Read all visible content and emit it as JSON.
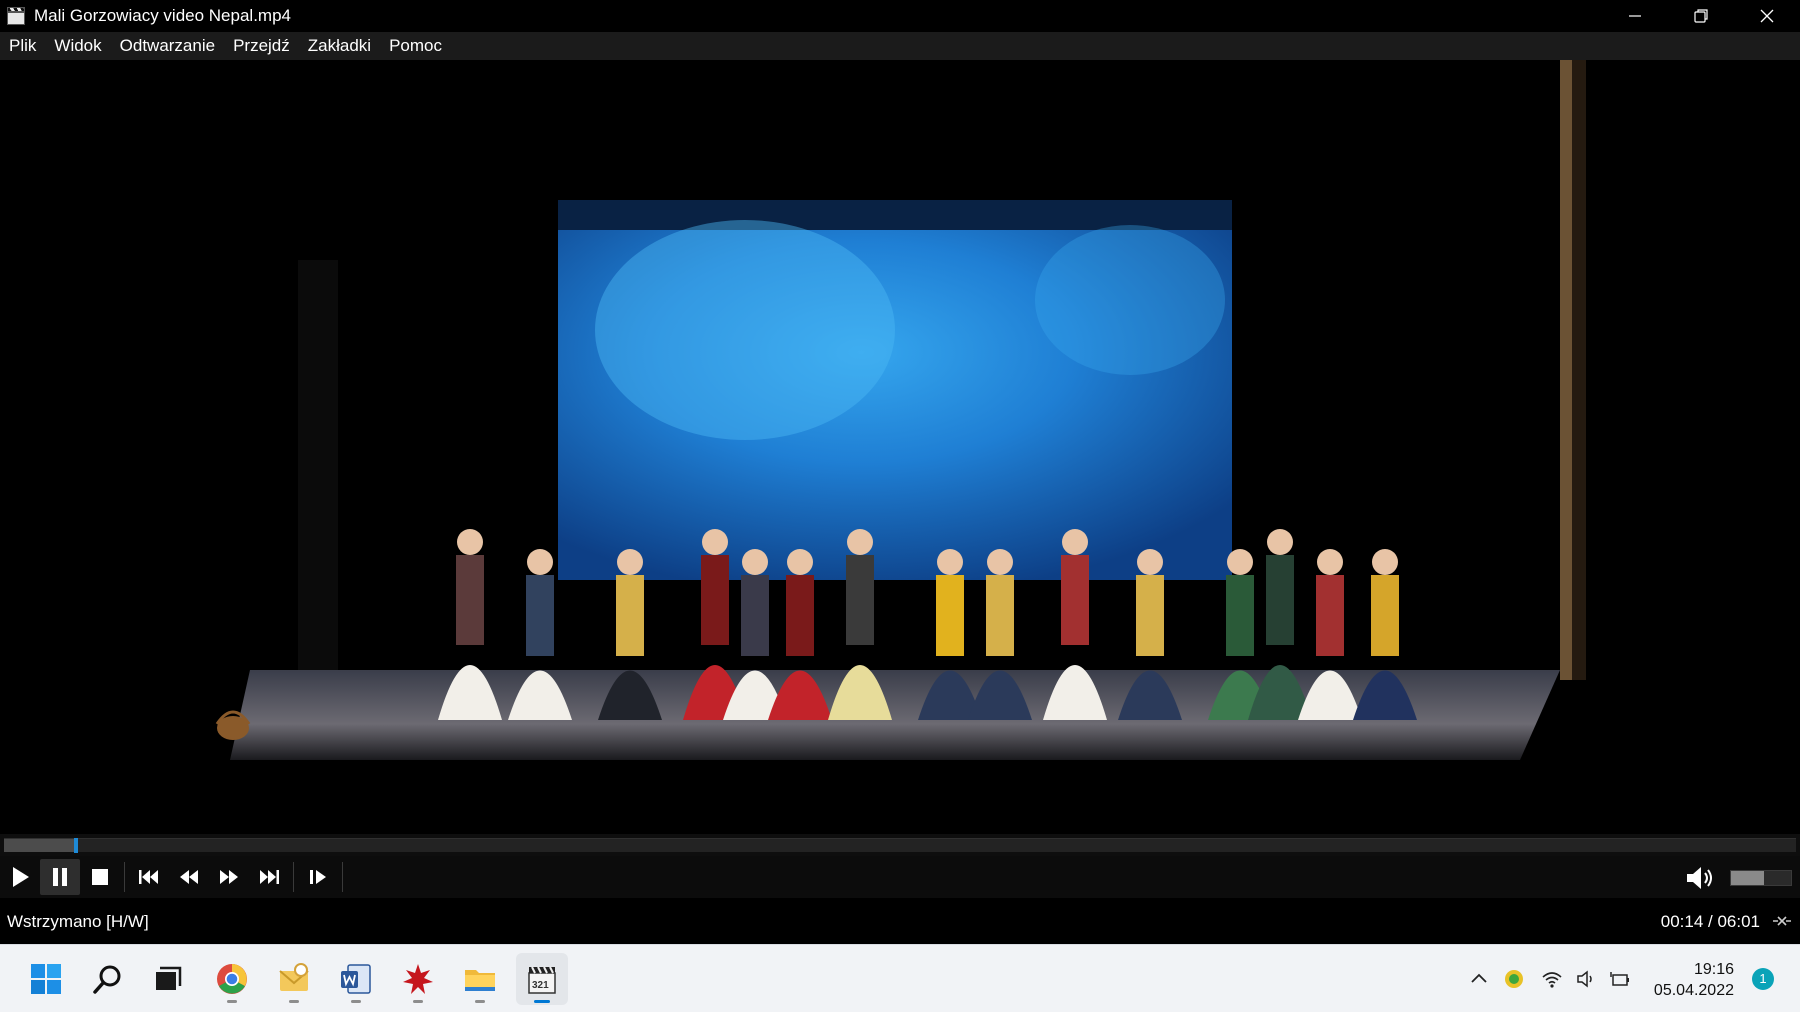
{
  "window": {
    "title": "Mali Gorzowiacy video Nepal.mp4",
    "icon": "clapperboard-icon"
  },
  "menu": {
    "items": [
      "Plik",
      "Widok",
      "Odtwarzanie",
      "Przejdź",
      "Zakładki",
      "Pomoc"
    ]
  },
  "player": {
    "progress_fraction": 0.039,
    "volume_fraction": 0.55,
    "status": "Wstrzymano [H/W]",
    "time": "00:14 / 06:01"
  },
  "controls": {
    "buttons": [
      "play-icon",
      "pause-icon",
      "stop-icon",
      "skip-previous-icon",
      "rewind-icon",
      "fast-forward-icon",
      "skip-next-icon",
      "frame-step-icon"
    ],
    "pressed": "pause-icon"
  },
  "taskbar": {
    "apps": [
      "windows-start-icon",
      "search-icon",
      "task-view-icon",
      "chrome-icon",
      "outlook-icon",
      "word-icon",
      "app-icon",
      "file-explorer-icon",
      "media-player-classic-icon"
    ],
    "active_app": "media-player-classic-icon",
    "tray_icons": [
      "chevron-up-icon",
      "antivirus-icon",
      "wifi-icon",
      "speaker-icon",
      "battery-icon"
    ],
    "clock_time": "19:16",
    "clock_date": "05.04.2022",
    "notification_count": "1"
  },
  "colors": {
    "seek_handle": "#1e8ad6",
    "backdrop_blue": "#1f7fd4",
    "taskbar_bg": "#f1f3f6",
    "notification_badge": "#0aa3b8"
  }
}
